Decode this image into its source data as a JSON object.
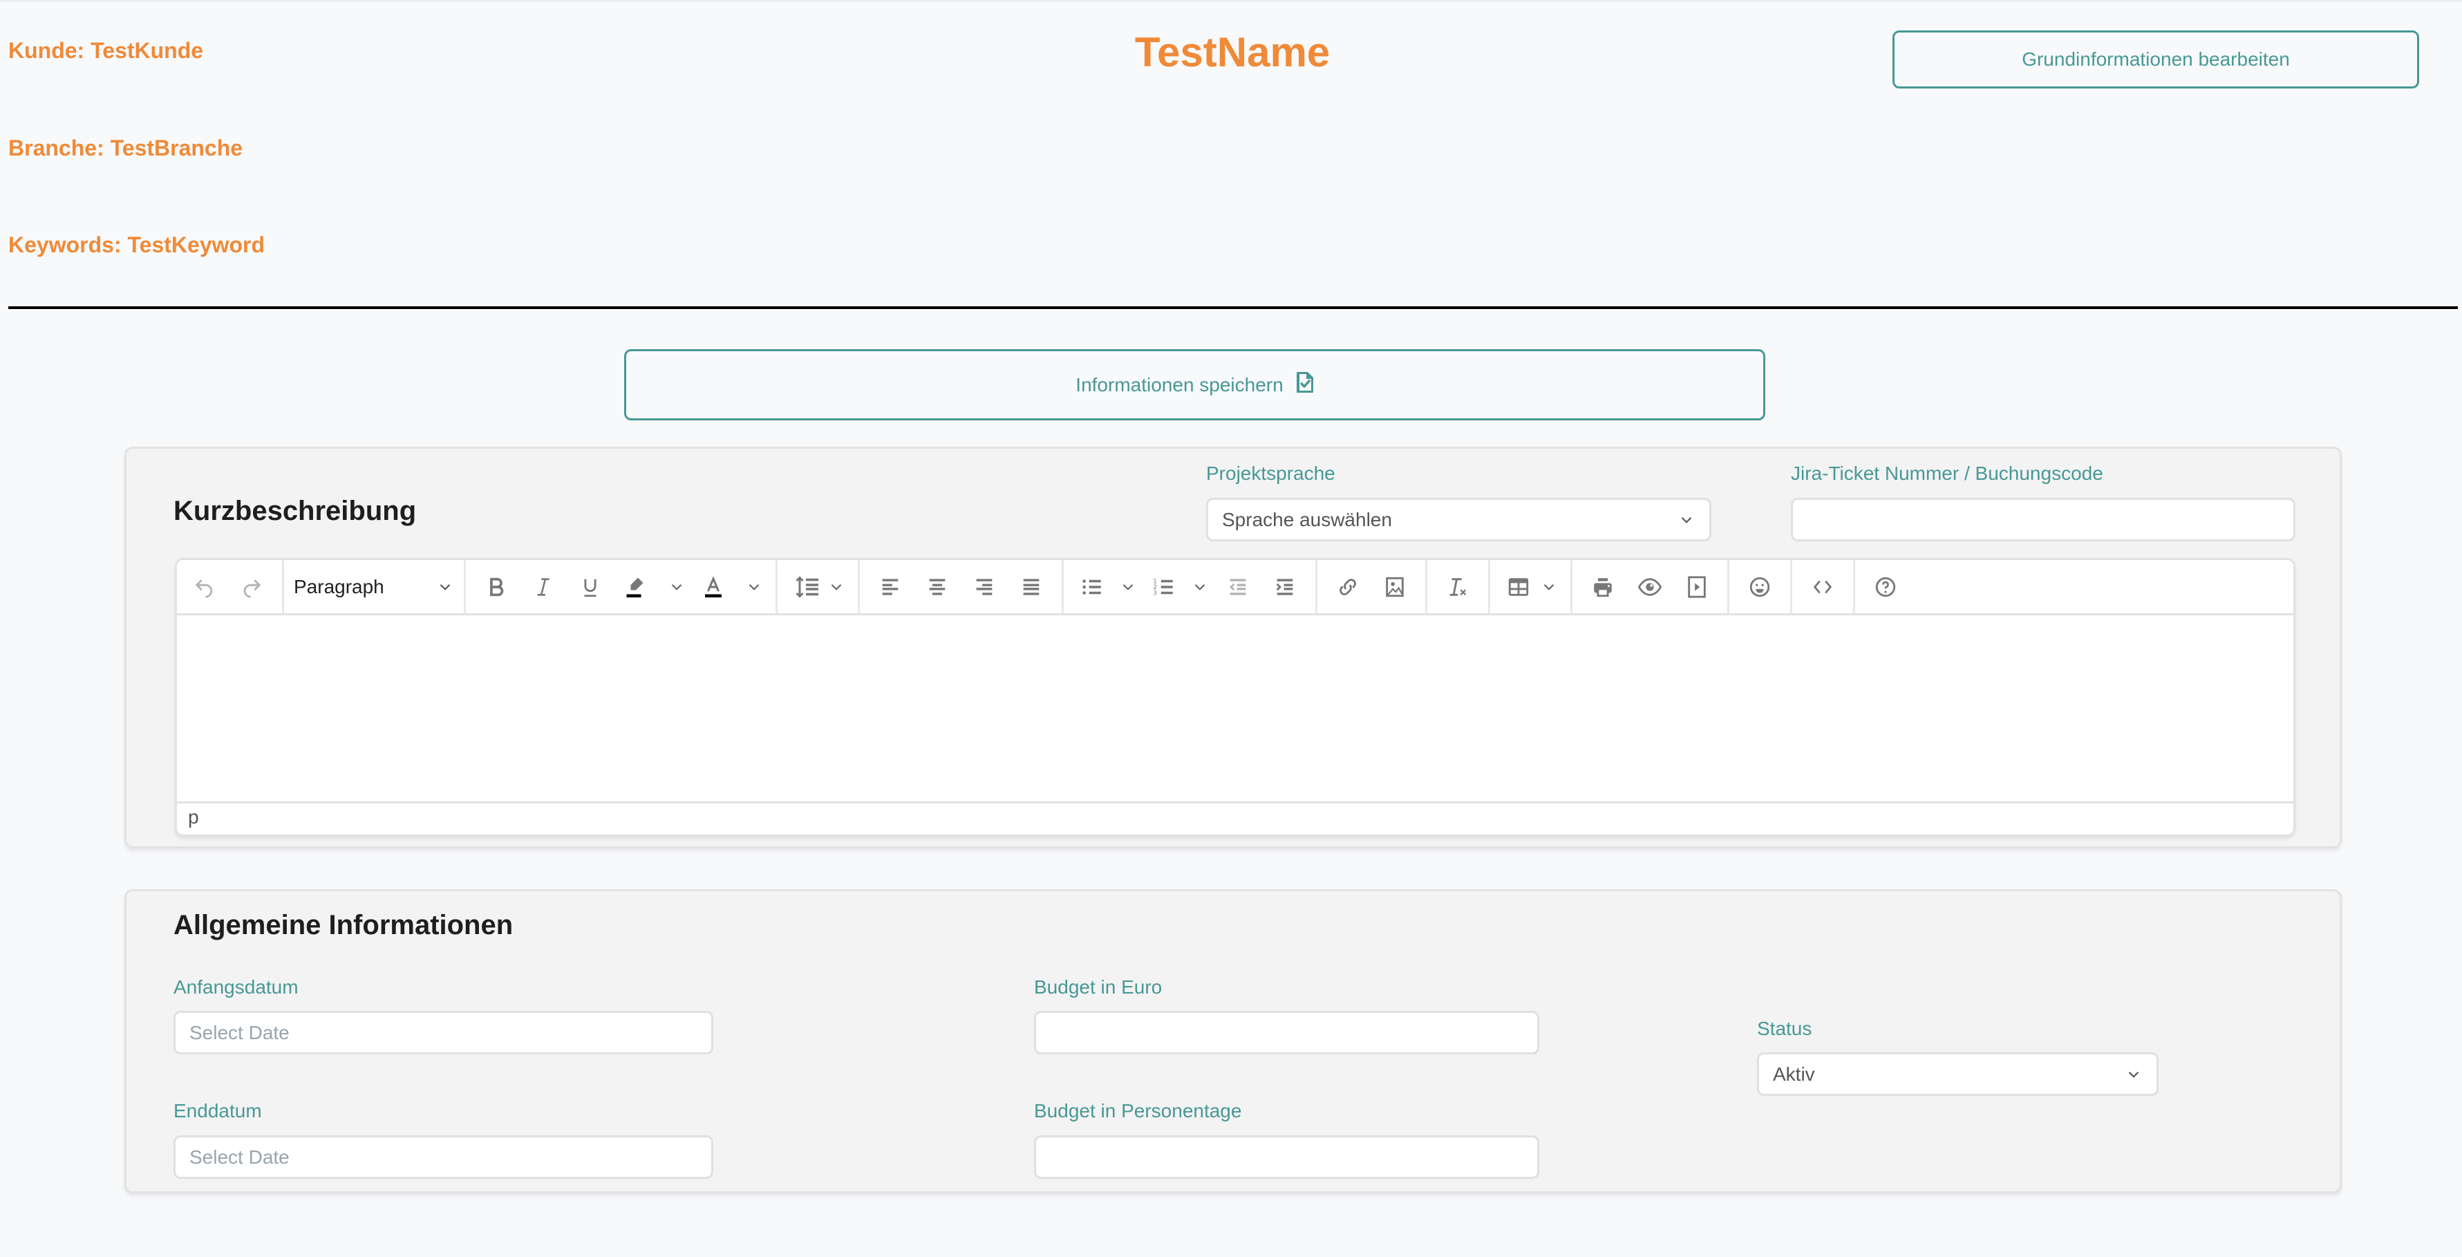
{
  "header": {
    "customer": "Kunde: TestKunde",
    "industry": "Branche: TestBranche",
    "keywords": "Keywords: TestKeyword",
    "title": "TestName",
    "edit_button_label": "Grundinformationen bearbeiten"
  },
  "save_button": {
    "label": "Informationen speichern",
    "icon": "file-check-icon"
  },
  "short_description": {
    "title": "Kurzbeschreibung",
    "language": {
      "label": "Projektsprache",
      "selected": "Sprache auswählen"
    },
    "jira": {
      "label": "Jira-Ticket Nummer / Buchungscode",
      "value": ""
    },
    "editor": {
      "block_format": "Paragraph",
      "content": "",
      "status_path": "p",
      "toolbar_icons": [
        "undo-icon",
        "redo-icon",
        "bold-icon",
        "italic-icon",
        "underline-icon",
        "highlight-color-icon",
        "text-color-icon",
        "line-height-icon",
        "align-left-icon",
        "align-center-icon",
        "align-right-icon",
        "align-justify-icon",
        "bullet-list-icon",
        "numbered-list-icon",
        "outdent-icon",
        "indent-icon",
        "link-icon",
        "image-icon",
        "clear-formatting-icon",
        "table-icon",
        "print-icon",
        "preview-icon",
        "media-icon",
        "emoji-icon",
        "source-code-icon",
        "help-icon"
      ]
    }
  },
  "general_info": {
    "title": "Allgemeine Informationen",
    "start_date": {
      "label": "Anfangsdatum",
      "placeholder": "Select Date",
      "value": ""
    },
    "end_date": {
      "label": "Enddatum",
      "placeholder": "Select Date",
      "value": ""
    },
    "budget_euro": {
      "label": "Budget in Euro",
      "value": ""
    },
    "budget_days": {
      "label": "Budget in Personentage",
      "value": ""
    },
    "status": {
      "label": "Status",
      "selected": "Aktiv"
    }
  },
  "colors": {
    "accent_orange": "#ef8a38",
    "accent_teal": "#479896"
  }
}
